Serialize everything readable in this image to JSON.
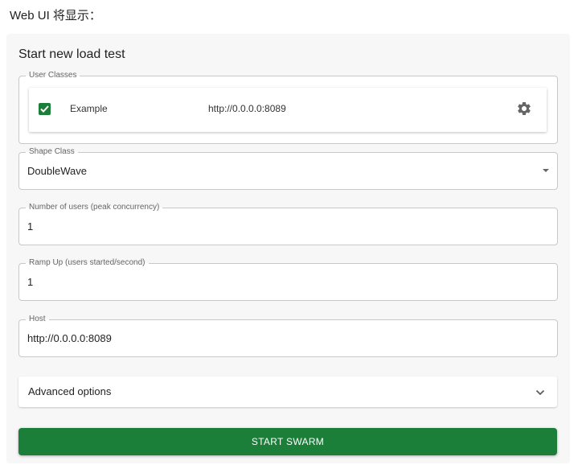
{
  "intro_text": "Web UI 将显示：",
  "panel": {
    "title": "Start new load test"
  },
  "user_classes": {
    "legend": "User Classes",
    "items": [
      {
        "checked": true,
        "name": "Example",
        "host": "http://0.0.0.0:8089",
        "settings_icon": "gear-icon"
      }
    ]
  },
  "shape_class": {
    "legend": "Shape Class",
    "value": "DoubleWave",
    "icon": "dropdown-arrow-icon"
  },
  "users": {
    "legend": "Number of users (peak concurrency)",
    "value": "1"
  },
  "ramp_up": {
    "legend": "Ramp Up (users started/second)",
    "value": "1"
  },
  "host": {
    "legend": "Host",
    "value": "http://0.0.0.0:8089"
  },
  "advanced": {
    "label": "Advanced options",
    "icon": "chevron-down-icon"
  },
  "start_button": {
    "label": "START SWARM"
  },
  "colors": {
    "accent": "#1b7e39",
    "panel_bg": "#f7f7f7",
    "border": "#c8c8c8"
  }
}
